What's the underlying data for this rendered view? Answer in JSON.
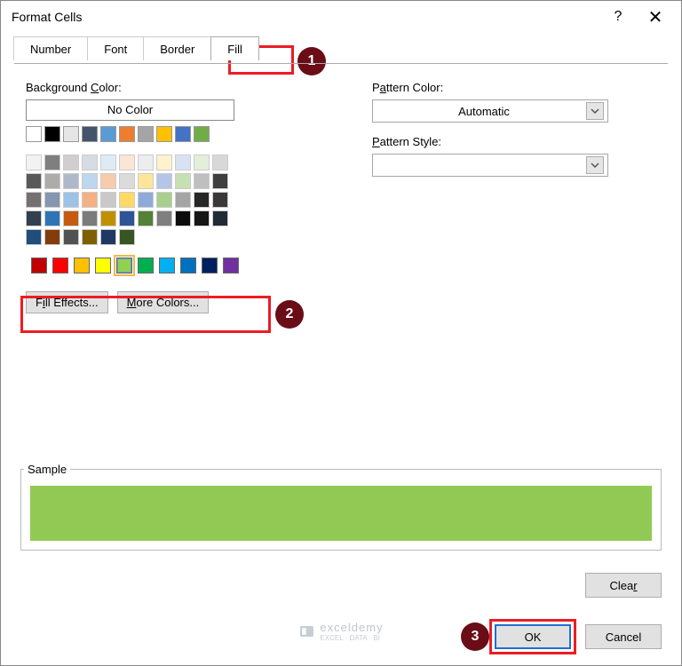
{
  "dialog": {
    "title": "Format Cells"
  },
  "tabs": {
    "number": "Number",
    "font": "Font",
    "border": "Border",
    "fill": "Fill"
  },
  "left": {
    "bg_label": "Background Color:",
    "nocolor": "No Color",
    "fill_effects": "Fill Effects...",
    "more_colors": "More Colors..."
  },
  "right": {
    "pattern_color_label": "Pattern Color:",
    "pattern_color_value": "Automatic",
    "pattern_style_label": "Pattern Style:",
    "pattern_style_value": ""
  },
  "sample": {
    "label": "Sample",
    "fill": "#92c954"
  },
  "buttons": {
    "clear": "Clear",
    "ok": "OK",
    "cancel": "Cancel"
  },
  "colors_top": [
    "#ffffff",
    "#000000",
    "#e7e6e6",
    "#44546a",
    "#5b9bd5",
    "#ed7d31",
    "#a5a5a5",
    "#ffc000",
    "#4472c4",
    "#70ad47"
  ],
  "colors_grid": [
    "#f2f2f2",
    "#7f7f7f",
    "#d0cece",
    "#d6dce4",
    "#deebf6",
    "#fbe5d5",
    "#ededed",
    "#fff2cc",
    "#d9e2f3",
    "#e2efd9",
    "#d8d8d8",
    "#595959",
    "#aeabab",
    "#adb9ca",
    "#bdd7ee",
    "#f7cbac",
    "#dbdbdb",
    "#fee599",
    "#b4c6e7",
    "#c5e0b3",
    "#bfbfbf",
    "#3f3f3f",
    "#757070",
    "#8496b0",
    "#9cc3e5",
    "#f4b183",
    "#c9c9c9",
    "#ffd965",
    "#8eaadb",
    "#a8d08d",
    "#a5a5a5",
    "#262626",
    "#3a3838",
    "#323f4f",
    "#2e75b5",
    "#c55a11",
    "#7b7b7b",
    "#bf9000",
    "#2f5496",
    "#538135",
    "#7f7f7f",
    "#0c0c0c",
    "#171616",
    "#222a35",
    "#1e4e79",
    "#833c0b",
    "#525252",
    "#7f6000",
    "#1f3864",
    "#375623"
  ],
  "standard_colors": [
    "#c00000",
    "#ff0000",
    "#ffc000",
    "#ffff00",
    "#92d050",
    "#00b050",
    "#00b0f0",
    "#0070c0",
    "#002060",
    "#7030a0"
  ],
  "selected_standard": 4,
  "callouts": {
    "one": "1",
    "two": "2",
    "three": "3"
  },
  "watermark": {
    "brand": "exceldemy",
    "sub": "EXCEL · DATA · BI"
  }
}
